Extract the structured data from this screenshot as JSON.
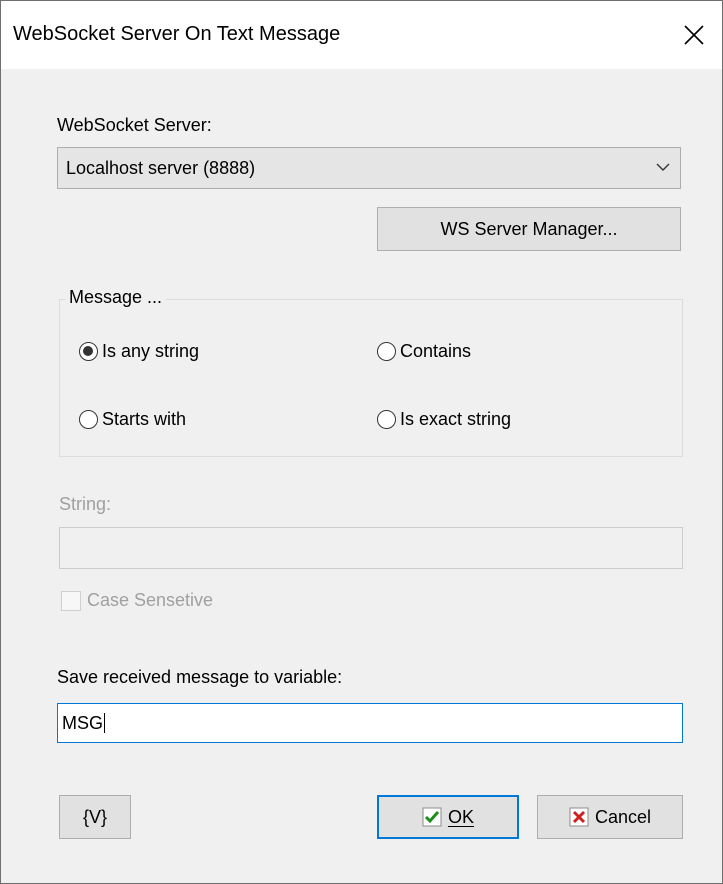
{
  "window": {
    "title": "WebSocket Server On Text Message"
  },
  "server": {
    "label": "WebSocket Server:",
    "selected": "Localhost server (8888)",
    "manager_button": "WS Server Manager..."
  },
  "message_group": {
    "title": "Message ...",
    "options": [
      "Is any string",
      "Contains",
      "Starts with",
      "Is exact string"
    ],
    "selected": "Is any string"
  },
  "string": {
    "label": "String:",
    "value": ""
  },
  "case_sensitive": {
    "label": "Case Sensetive",
    "checked": false
  },
  "save": {
    "label": "Save received message to variable:",
    "value": "MSG"
  },
  "buttons": {
    "variables": "{V}",
    "ok": "OK",
    "cancel": "Cancel"
  },
  "colors": {
    "ok_check": "#1c8e1c",
    "cancel_x": "#d02020",
    "focus_border": "#0078d7"
  }
}
